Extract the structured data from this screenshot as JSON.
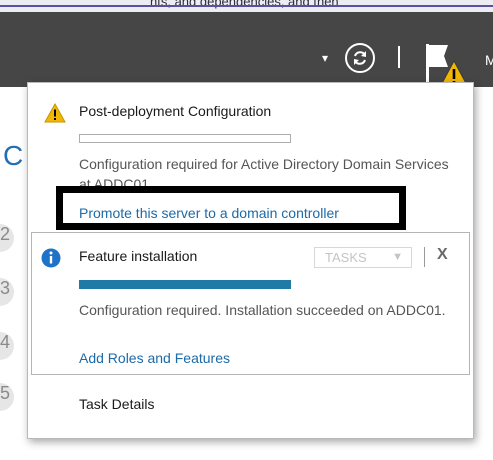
{
  "toolbar": {
    "top_strip_text": "nts, and dependencies, and then",
    "dropdown_glyph": "▾",
    "user_initial": "M"
  },
  "background": {
    "partial_heading": "C",
    "step_numbers": [
      "2",
      "3",
      "4",
      "5"
    ]
  },
  "notifications": [
    {
      "title": "Post-deployment Configuration",
      "description": "Configuration required for Active Directory Domain Services at ADDC01.",
      "link": "Promote this server to a domain controller",
      "progress": 0,
      "status_icon": "warning-icon"
    },
    {
      "title": "Feature installation",
      "tasks_label": "TASKS",
      "close_glyph": "X",
      "description": "Configuration required. Installation succeeded on ADDC01.",
      "link": "Add Roles and Features",
      "progress": 1.0,
      "status_icon": "info-icon"
    }
  ],
  "footer": {
    "task_details": "Task Details"
  },
  "colors": {
    "toolbar_bg": "#464646",
    "link": "#1c6aa8",
    "progress_fill": "#1f7aa6",
    "warning": "#f2b705",
    "info": "#1e73c8",
    "highlight": "#000000"
  }
}
